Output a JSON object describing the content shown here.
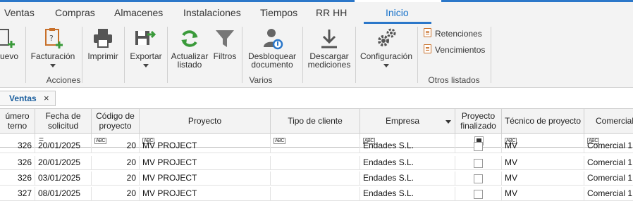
{
  "tabs": [
    "Ventas",
    "Compras",
    "Almacenes",
    "Instalaciones",
    "Tiempos",
    "RR HH",
    "Inicio"
  ],
  "ribbon": {
    "nuevo": "uevo",
    "facturacion": "Facturación",
    "imprimir": "Imprimir",
    "exportar": "Exportar",
    "actualizar_1": "Actualizar",
    "actualizar_2": "listado",
    "filtros": "Filtros",
    "desbloquear_1": "Desbloquear",
    "desbloquear_2": "documento",
    "descargar_1": "Descargar",
    "descargar_2": "mediciones",
    "configuracion": "Configuración",
    "retenciones": "Retenciones",
    "vencimientos": "Vencimientos",
    "group_acciones": "Acciones",
    "group_varios": "Varios",
    "group_otros": "Otros listados"
  },
  "doc_tab": {
    "label": "Ventas",
    "close": "×"
  },
  "grid": {
    "headers": {
      "numero_1": "úmero",
      "numero_2": "terno",
      "fecha_1": "Fecha de",
      "fecha_2": "solicitud",
      "codigo_1": "Código de",
      "codigo_2": "proyecto",
      "proyecto": "Proyecto",
      "tipo_cliente": "Tipo de cliente",
      "empresa": "Empresa",
      "finalizado_1": "Proyecto",
      "finalizado_2": "finalizado",
      "tecnico": "Técnico de proyecto",
      "comercial": "Comercial"
    },
    "filter_abc": "ABC",
    "filter_eq": "=",
    "rows": [
      {
        "num": "326",
        "fecha": "20/01/2025",
        "codigo": "20",
        "proyecto": "MV PROJECT",
        "empresa": "Endades S.L.",
        "tecnico": "MV",
        "comercial": "Comercial 1"
      },
      {
        "num": "326",
        "fecha": "20/01/2025",
        "codigo": "20",
        "proyecto": "MV PROJECT",
        "empresa": "Endades S.L.",
        "tecnico": "MV",
        "comercial": "Comercial 1"
      },
      {
        "num": "326",
        "fecha": "03/01/2025",
        "codigo": "20",
        "proyecto": "MV PROJECT",
        "empresa": "Endades S.L.",
        "tecnico": "MV",
        "comercial": "Comercial 1"
      },
      {
        "num": "327",
        "fecha": "08/01/2025",
        "codigo": "20",
        "proyecto": "MV PROJECT",
        "empresa": "Endades S.L.",
        "tecnico": "MV",
        "comercial": "Comercial 1"
      }
    ]
  },
  "colors": {
    "accent": "#2b77c9",
    "ribbon_bg": "#f3f3f3"
  }
}
